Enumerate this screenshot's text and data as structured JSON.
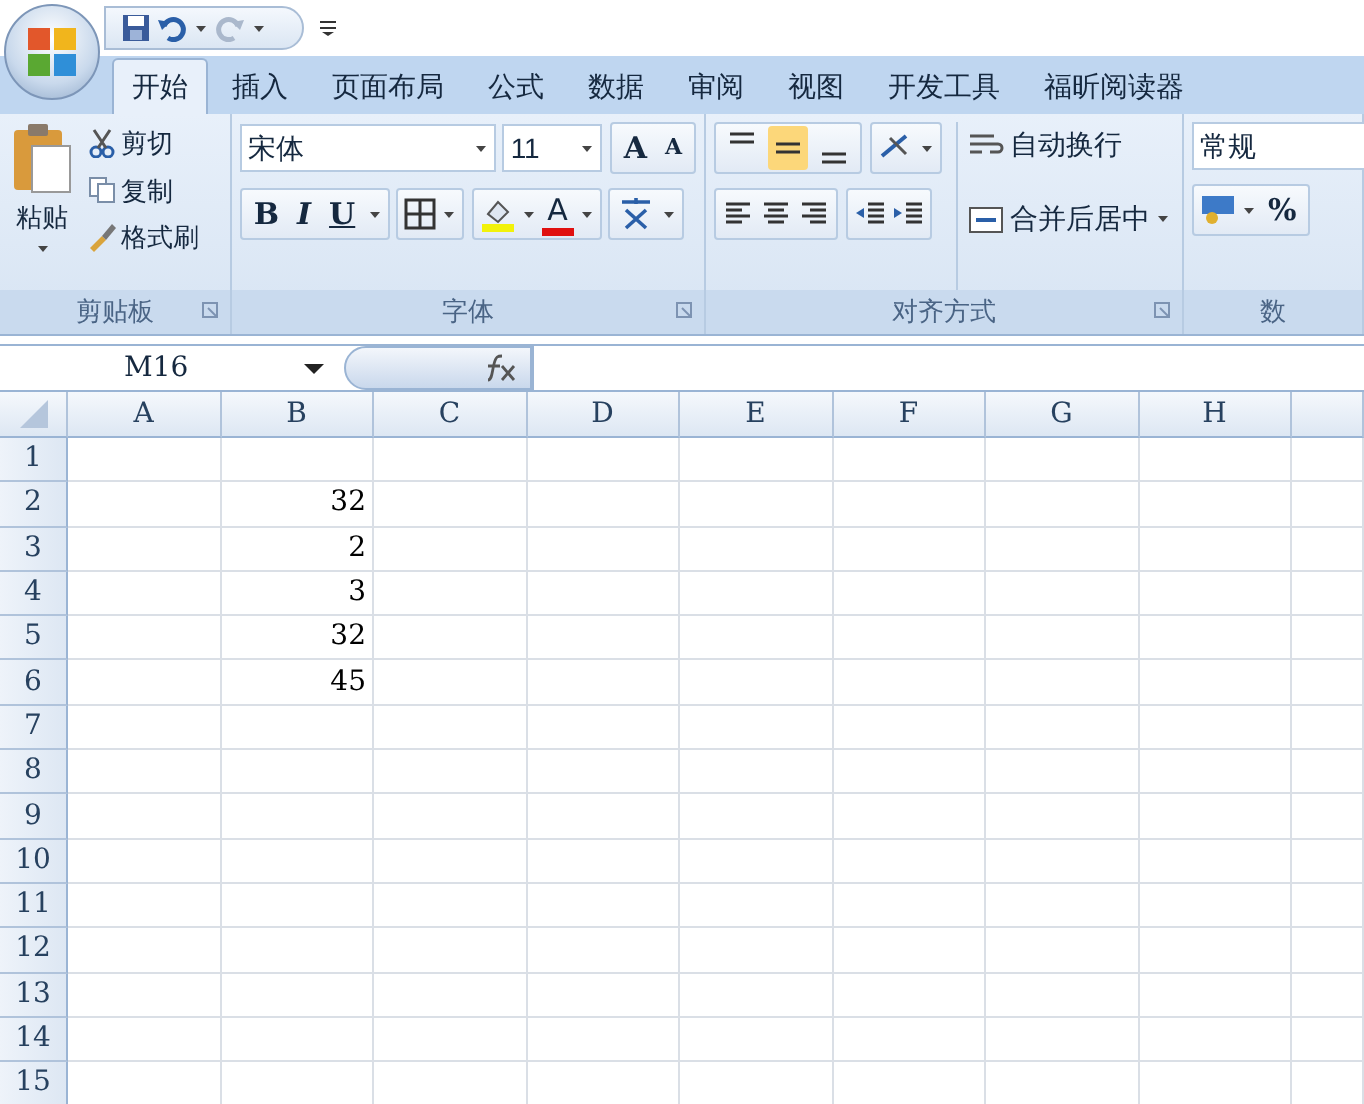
{
  "tabs": [
    {
      "label": "开始",
      "selected": true
    },
    {
      "label": "插入",
      "selected": false
    },
    {
      "label": "页面布局",
      "selected": false
    },
    {
      "label": "公式",
      "selected": false
    },
    {
      "label": "数据",
      "selected": false
    },
    {
      "label": "审阅",
      "selected": false
    },
    {
      "label": "视图",
      "selected": false
    },
    {
      "label": "开发工具",
      "selected": false
    },
    {
      "label": "福昕阅读器",
      "selected": false
    }
  ],
  "clipboard": {
    "paste": "粘贴",
    "cut": "剪切",
    "copy": "复制",
    "format_painter": "格式刷",
    "label": "剪贴板"
  },
  "font": {
    "font_name": "宋体",
    "font_size": "11",
    "grow": "A",
    "shrink": "A",
    "bold": "B",
    "italic": "I",
    "underline": "U",
    "font_color": "A",
    "label": "字体"
  },
  "alignment": {
    "vertical": [
      {
        "selected": false
      },
      {
        "selected": true
      },
      {
        "selected": false
      }
    ],
    "wrap_text": "自动换行",
    "merge_center": "合并后居中",
    "label": "对齐方式"
  },
  "number": {
    "format": "常规",
    "percent": "%",
    "label": "数"
  },
  "formula_bar": {
    "name_box": "M16"
  },
  "sheet": {
    "columns": [
      "A",
      "B",
      "C",
      "D",
      "E",
      "F",
      "G",
      "H"
    ],
    "rows": [
      {
        "header": "1",
        "cells": [
          "",
          ""
        ]
      },
      {
        "header": "2",
        "cells": [
          "",
          "32"
        ]
      },
      {
        "header": "3",
        "cells": [
          "",
          "2"
        ]
      },
      {
        "header": "4",
        "cells": [
          "",
          "3"
        ]
      },
      {
        "header": "5",
        "cells": [
          "",
          "32"
        ]
      },
      {
        "header": "6",
        "cells": [
          "",
          "45"
        ]
      },
      {
        "header": "7",
        "cells": [
          "",
          ""
        ]
      },
      {
        "header": "8",
        "cells": [
          "",
          ""
        ]
      },
      {
        "header": "9",
        "cells": [
          "",
          ""
        ]
      },
      {
        "header": "10",
        "cells": [
          "",
          ""
        ]
      },
      {
        "header": "11",
        "cells": [
          "",
          ""
        ]
      },
      {
        "header": "12",
        "cells": [
          "",
          ""
        ]
      },
      {
        "header": "13",
        "cells": [
          "",
          ""
        ]
      },
      {
        "header": "14",
        "cells": [
          "",
          ""
        ]
      },
      {
        "header": "15",
        "cells": [
          "",
          ""
        ]
      }
    ]
  }
}
